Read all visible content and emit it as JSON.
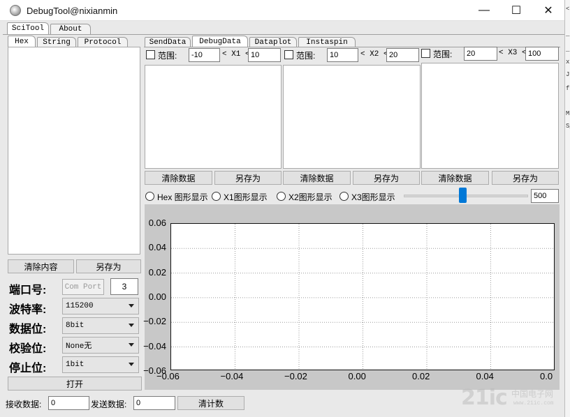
{
  "window": {
    "title": "DebugTool@nixianmin",
    "minimize": "—",
    "maximize": "☐",
    "close": "✕"
  },
  "main_tabs": [
    "SciTool",
    "About"
  ],
  "left_tabs": [
    "Hex",
    "String",
    "Protocol"
  ],
  "left_buttons": {
    "clear": "清除内容",
    "save": "另存为"
  },
  "port": {
    "port_label": "端口号:",
    "port_button": "Com Port",
    "port_value": "3",
    "baud_label": "波特率:",
    "baud_value": "115200",
    "data_label": "数据位:",
    "data_value": "8bit",
    "parity_label": "校验位:",
    "parity_value": "None无",
    "stop_label": "停止位:",
    "stop_value": "1bit",
    "open_button": "打开"
  },
  "right_tabs": [
    "SendData",
    "DebugData",
    "Dataplot",
    "Instaspin"
  ],
  "ranges": [
    {
      "label": "范围:",
      "min": "-10",
      "axis": "< X1 <",
      "max": "10"
    },
    {
      "label": "范围:",
      "min": "10",
      "axis": "< X2 <",
      "max": "20"
    },
    {
      "label": "范围:",
      "min": "20",
      "axis": "< X3 <",
      "max": "100"
    }
  ],
  "panel_buttons": {
    "clear": "清除数据",
    "save": "另存为"
  },
  "radios": [
    "Hex 图形显示",
    "X1图形显示",
    "X2图形显示",
    "X3图形显示"
  ],
  "slider": {
    "value": 500,
    "position": 0.47
  },
  "status": {
    "recv_label": "接收数据:",
    "recv_value": "0",
    "send_label": "发送数据:",
    "send_value": "0",
    "reset_button": "清计数"
  },
  "watermark": {
    "logo": "21ic",
    "text": "中国电子网",
    "url": "www.21ic.com"
  },
  "background_strip": [
    "<I",
    "_l",
    "_h",
    "x",
    "Ju",
    "f",
    "M",
    "S_"
  ],
  "chart_data": {
    "type": "line",
    "series": [],
    "xlim": [
      -0.06,
      0.06
    ],
    "ylim": [
      -0.06,
      0.06
    ],
    "xticks": [
      "−0.06",
      "−0.04",
      "−0.02",
      "0.00",
      "0.02",
      "0.04",
      "0.0"
    ],
    "yticks": [
      "0.06",
      "0.04",
      "0.02",
      "0.00",
      "−0.02",
      "−0.04",
      "−0.06"
    ],
    "grid": true
  }
}
